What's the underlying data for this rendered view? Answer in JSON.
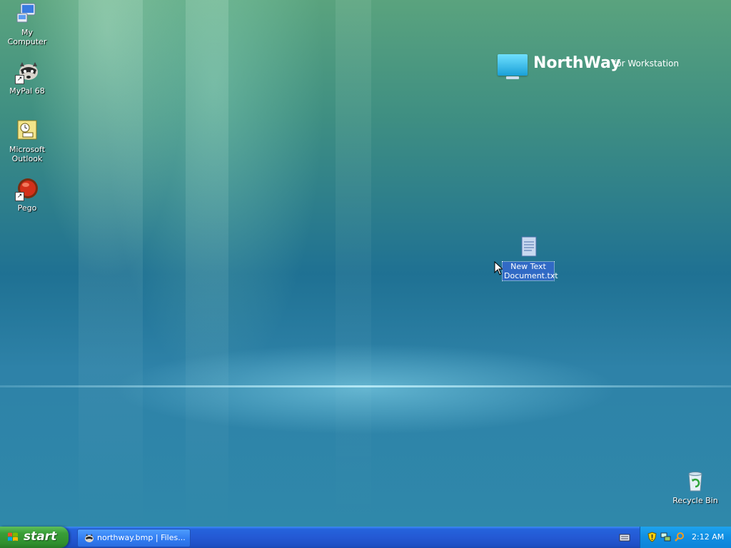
{
  "desktop": {
    "icons": [
      {
        "label": "My Computer"
      },
      {
        "label": "MyPal 68"
      },
      {
        "label": "Microsoft Outlook"
      },
      {
        "label": "Pego"
      },
      {
        "label": "New Text Document.txt"
      },
      {
        "label": "Recycle Bin"
      }
    ],
    "brand": {
      "name": "NorthWay",
      "subtitle": "for Workstation"
    }
  },
  "taskbar": {
    "start_label": "start",
    "tasks": [
      {
        "label": "northway.bmp | Files..."
      }
    ],
    "tray": {
      "icons": [
        "keyboard-icon",
        "security-shield-icon",
        "network-icon",
        "search-icon"
      ],
      "clock": "2:12 AM"
    }
  },
  "colors": {
    "taskbar_blue": "#245edc",
    "start_green": "#3a9e38",
    "tray_blue": "#108ee2",
    "selection": "#316ac5"
  }
}
